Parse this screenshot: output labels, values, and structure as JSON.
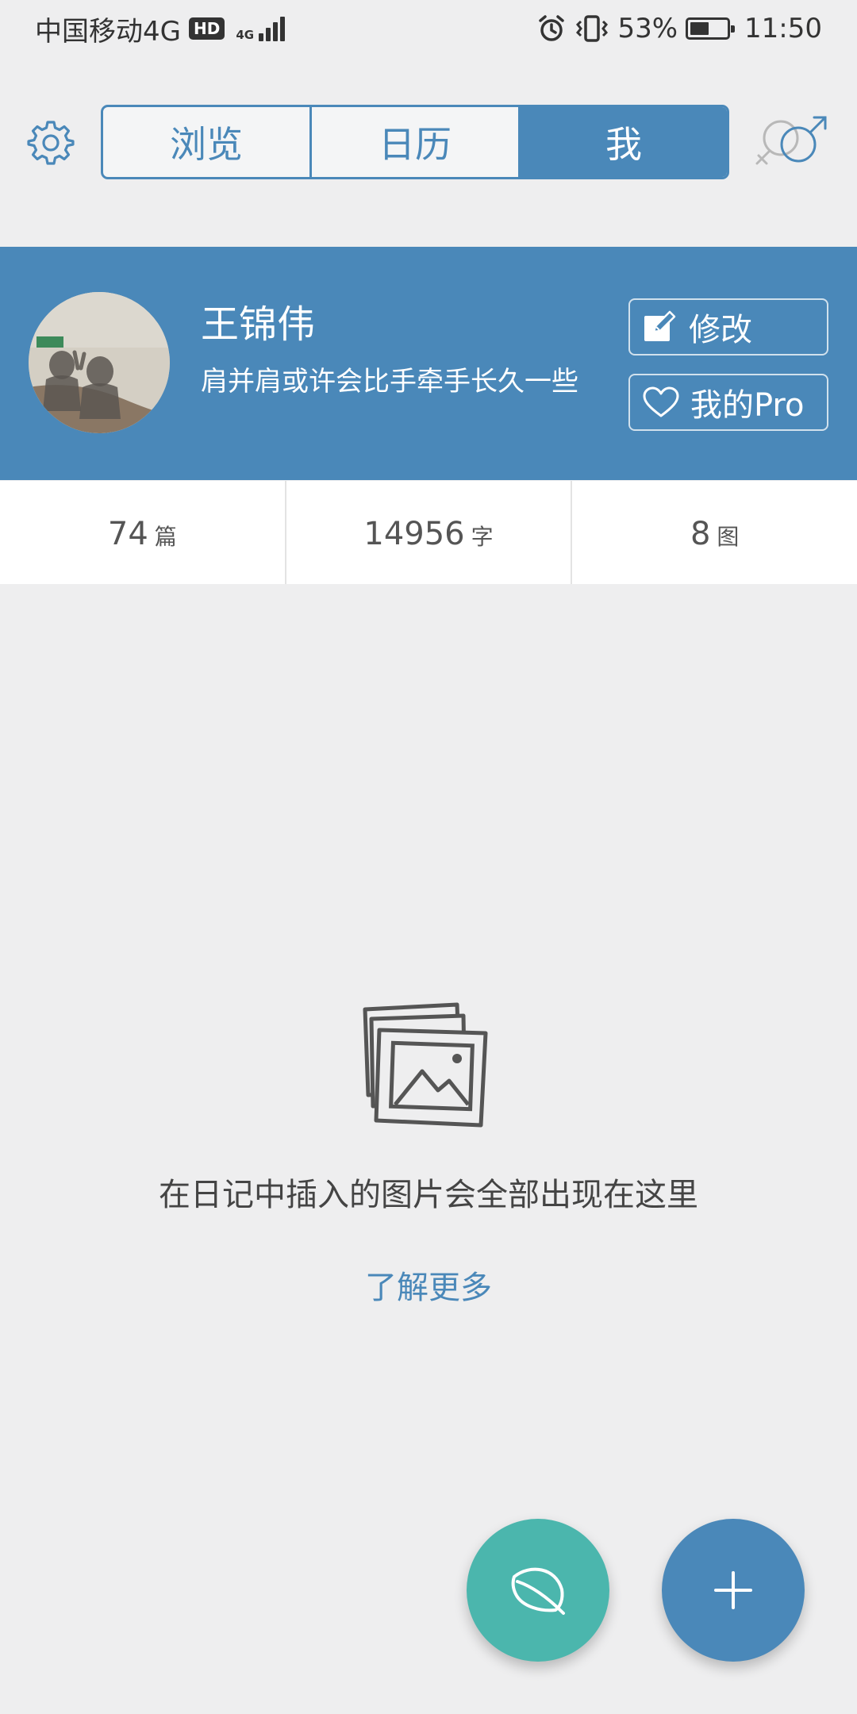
{
  "status_bar": {
    "carrier": "中国移动4G",
    "hd_badge": "HD",
    "signal_label": "4G",
    "battery": "53%",
    "battery_level": 0.53,
    "time": "11:50"
  },
  "nav": {
    "tabs": [
      {
        "label": "浏览",
        "active": false
      },
      {
        "label": "日历",
        "active": false
      },
      {
        "label": "我",
        "active": true
      }
    ]
  },
  "profile": {
    "name": "王锦伟",
    "bio": "肩并肩或许会比手牵手长久一些",
    "edit_label": "修改",
    "pro_label": "我的Pro"
  },
  "stats": [
    {
      "value": "74",
      "unit": "篇"
    },
    {
      "value": "14956",
      "unit": "字"
    },
    {
      "value": "8",
      "unit": "图"
    }
  ],
  "empty_state": {
    "message": "在日记中插入的图片会全部出现在这里",
    "link": "了解更多"
  },
  "colors": {
    "accent": "#4a88b9",
    "fab_leaf": "#4bb6ad",
    "background": "#eeeeef"
  }
}
